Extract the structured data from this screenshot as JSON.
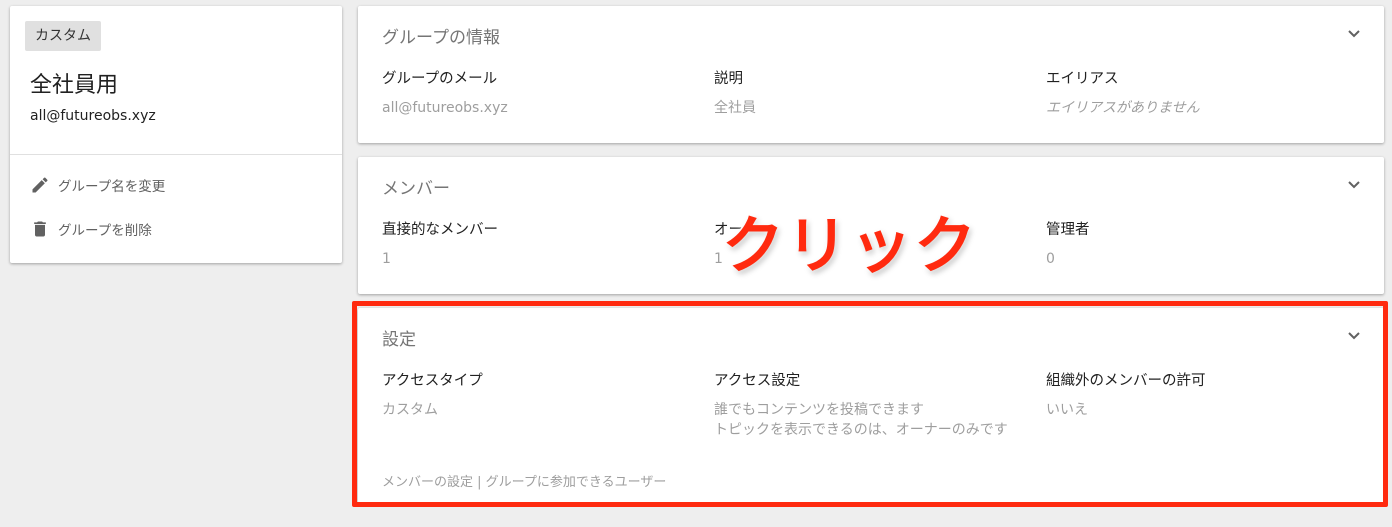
{
  "left_card": {
    "chip": "カスタム",
    "group_name": "全社員用",
    "group_email": "all@futureobs.xyz",
    "actions": [
      {
        "icon": "pencil-icon",
        "label": "グループ名を変更"
      },
      {
        "icon": "trash-icon",
        "label": "グループを削除"
      }
    ]
  },
  "info_section": {
    "title": "グループの情報",
    "columns": [
      {
        "label": "グループのメール",
        "value": "all@futureobs.xyz"
      },
      {
        "label": "説明",
        "value": "全社員"
      },
      {
        "label": "エイリアス",
        "value": "エイリアスがありません"
      }
    ]
  },
  "members_section": {
    "title": "メンバー",
    "columns": [
      {
        "label": "直接的なメンバー",
        "value": "1"
      },
      {
        "label": "オー",
        "value": "1"
      },
      {
        "label": "管理者",
        "value": "0"
      }
    ]
  },
  "settings_section": {
    "title": "設定",
    "columns": [
      {
        "label": "アクセスタイプ",
        "value": "カスタム"
      },
      {
        "label": "アクセス設定",
        "value_line1": "誰でもコンテンツを投稿できます",
        "value_line2": "トピックを表示できるのは、オーナーのみです"
      },
      {
        "label": "組織外のメンバーの許可",
        "value": "いいえ"
      }
    ],
    "footer": {
      "link1": "メンバーの設定",
      "separator": " | ",
      "link2": "グループに参加できるユーザー"
    }
  },
  "annotation": {
    "text": "クリック",
    "highlight_color": "#ff2a0f"
  },
  "colors": {
    "background": "#eeeeee",
    "card": "#ffffff",
    "muted_text": "#9e9e9e",
    "title_text": "#757575"
  }
}
